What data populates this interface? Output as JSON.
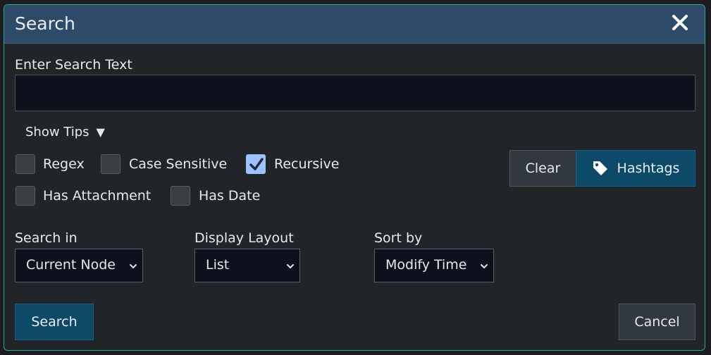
{
  "dialog": {
    "title": "Search",
    "search_label": "Enter Search Text",
    "search_value": "",
    "show_tips": "Show Tips",
    "show_tips_arrow": "▼",
    "options": {
      "regex": {
        "label": "Regex",
        "checked": false
      },
      "case_sensitive": {
        "label": "Case Sensitive",
        "checked": false
      },
      "recursive": {
        "label": "Recursive",
        "checked": true
      },
      "has_attachment": {
        "label": "Has Attachment",
        "checked": false
      },
      "has_date": {
        "label": "Has Date",
        "checked": false
      }
    },
    "clear_label": "Clear",
    "hashtags_label": "Hashtags",
    "search_in": {
      "label": "Search in",
      "value": "Current Node"
    },
    "display_layout": {
      "label": "Display Layout",
      "value": "List"
    },
    "sort_by": {
      "label": "Sort by",
      "value": "Modify Time"
    },
    "search_button": "Search",
    "cancel_button": "Cancel"
  },
  "colors": {
    "titlebar": "#2e4a69",
    "border_accent": "#2fa58a",
    "primary_button": "#0d4a6a",
    "checkbox_checked": "#9cc2ff"
  }
}
